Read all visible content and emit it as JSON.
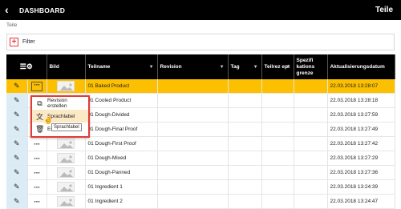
{
  "topbar": {
    "back_label": "‹",
    "app_title": "DASHBOARD",
    "page_title": "Teile"
  },
  "breadcrumb": "Teile",
  "filter": {
    "label": "Filter",
    "add_icon": "plus-icon"
  },
  "columns": [
    {
      "label": "",
      "icon": "settings-list-icon"
    },
    {
      "label": "Bild"
    },
    {
      "label": "Teilname"
    },
    {
      "label": "Revision"
    },
    {
      "label": "Tag"
    },
    {
      "label": "Teilrez ept"
    },
    {
      "label": "Spezifi kations grenze"
    },
    {
      "label": "Aktualisierungsdatum"
    }
  ],
  "rows": [
    {
      "name": "01 Baked Product",
      "date": "22.03.2018 13:28:07",
      "selected": true
    },
    {
      "name": "01 Cooled Product",
      "date": "22.03.2018 13:28:18"
    },
    {
      "name": "01 Dough-Divided",
      "date": "22.03.2018 13:27:59"
    },
    {
      "name": "01 Dough-Final Proof",
      "date": "22.03.2018 13:27:49"
    },
    {
      "name": "01 Dough-First Proof",
      "date": "22.03.2018 13:27:42"
    },
    {
      "name": "01 Dough-Mixed",
      "date": "22.03.2018 13:27:29"
    },
    {
      "name": "01 Dough-Panned",
      "date": "22.03.2018 13:27:36"
    },
    {
      "name": "01 Ingredient 1",
      "date": "22.03.2018 13:24:39"
    },
    {
      "name": "01 Ingredient 2",
      "date": "22.03.2018 13:24:47"
    }
  ],
  "context_menu": {
    "items": [
      {
        "label": "Revision erstellen",
        "icon": "revision-icon"
      },
      {
        "label": "Sprachlabel",
        "icon": "translate-icon"
      },
      {
        "label": "Entf",
        "icon": "trash-icon"
      }
    ]
  },
  "tooltip": "Sprachlabel",
  "colors": {
    "accent": "#fcc000",
    "highlight_border": "#e53935",
    "header_bg": "#000000"
  }
}
